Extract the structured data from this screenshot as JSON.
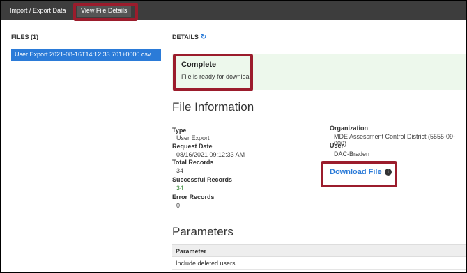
{
  "tabs": [
    {
      "label": "Import / Export Data"
    },
    {
      "label": "View File Details"
    }
  ],
  "sidebar": {
    "title": "FILES (1)",
    "files": [
      {
        "name": "User Export 2021-08-16T14:12:33.701+0000.csv"
      }
    ]
  },
  "details": {
    "title": "DETAILS",
    "refresh_icon": "refresh-icon"
  },
  "status": {
    "title": "Complete",
    "message": "File is ready for download"
  },
  "file_info": {
    "heading": "File Information",
    "type_label": "Type",
    "type_value": "User Export",
    "request_date_label": "Request Date",
    "request_date_value": "08/16/2021 09:12:33 AM",
    "total_records_label": "Total Records",
    "total_records_value": "34",
    "successful_records_label": "Successful Records",
    "successful_records_value": "34",
    "error_records_label": "Error Records",
    "error_records_value": "0",
    "organization_label": "Organization",
    "organization_value": "MDE Assessment Control District (5555-09-000)",
    "user_label": "User",
    "user_value": "DAC-Braden",
    "download_label": "Download File",
    "info_icon": "info-icon"
  },
  "parameters": {
    "heading": "Parameters",
    "column": "Parameter",
    "rows": [
      {
        "name": "Include deleted users"
      }
    ]
  },
  "colors": {
    "tabbar": "#3d3d3d",
    "accent": "#2b7bd8",
    "highlight": "#9b1c2c",
    "status_bg": "#edf8ec"
  }
}
